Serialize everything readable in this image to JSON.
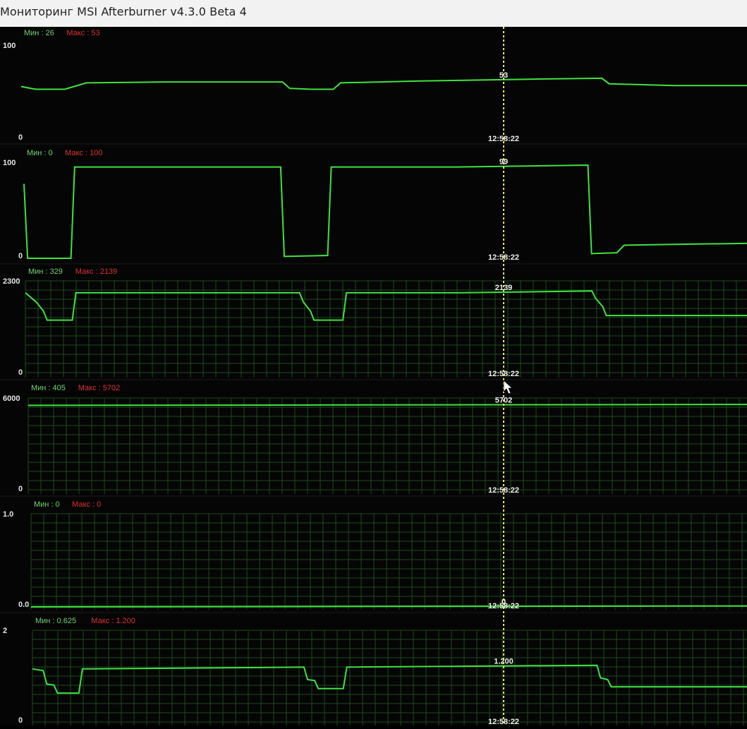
{
  "window": {
    "title": "Мониторинг MSI Afterburner v4.3.0 Beta 4"
  },
  "cursor_time": "12:58:22",
  "colors": {
    "line": "#3fe23f",
    "min_label": "#6fd66f",
    "max_label": "#e03030",
    "cursor": "#e8e860",
    "grid": "#1b4a1b",
    "bg": "#050505"
  },
  "graphs": [
    {
      "id": "graph-1",
      "min_text": "Мин : 26",
      "max_text": "Макс : 53",
      "y_max_label": "100",
      "y_min_label": "0",
      "current_value": "53",
      "time_label": "12:58:22",
      "grid": false,
      "series_percent": [
        [
          0.0,
          58
        ],
        [
          0.02,
          55
        ],
        [
          0.06,
          55
        ],
        [
          0.09,
          62
        ],
        [
          0.2,
          63
        ],
        [
          0.36,
          63
        ],
        [
          0.37,
          56
        ],
        [
          0.4,
          55
        ],
        [
          0.43,
          55
        ],
        [
          0.44,
          62
        ],
        [
          0.55,
          64
        ],
        [
          0.7,
          66
        ],
        [
          0.8,
          67
        ],
        [
          0.81,
          61
        ],
        [
          0.9,
          59
        ],
        [
          1.0,
          59
        ]
      ]
    },
    {
      "id": "graph-2",
      "min_text": "Мин : 0",
      "max_text": "Макс : 100",
      "y_max_label": "100",
      "y_min_label": "0",
      "current_value": "99",
      "time_label": "12:58:22",
      "grid": false,
      "series_percent": [
        [
          0.0,
          80
        ],
        [
          0.005,
          0
        ],
        [
          0.065,
          0
        ],
        [
          0.07,
          98
        ],
        [
          0.25,
          98
        ],
        [
          0.355,
          98
        ],
        [
          0.36,
          2
        ],
        [
          0.42,
          3
        ],
        [
          0.425,
          98
        ],
        [
          0.6,
          98
        ],
        [
          0.78,
          100
        ],
        [
          0.785,
          5
        ],
        [
          0.82,
          6
        ],
        [
          0.83,
          14
        ],
        [
          0.9,
          15
        ],
        [
          1.0,
          16
        ]
      ]
    },
    {
      "id": "graph-3",
      "min_text": "Мин : 329",
      "max_text": "Макс : 2139",
      "y_max_label": "2300",
      "y_min_label": "0",
      "current_value": "2139",
      "time_label": "12:58:22",
      "grid": true,
      "series_percent": [
        [
          0.0,
          90
        ],
        [
          0.015,
          80
        ],
        [
          0.025,
          70
        ],
        [
          0.03,
          60
        ],
        [
          0.065,
          60
        ],
        [
          0.07,
          90
        ],
        [
          0.3,
          90
        ],
        [
          0.38,
          90
        ],
        [
          0.385,
          80
        ],
        [
          0.395,
          70
        ],
        [
          0.4,
          60
        ],
        [
          0.44,
          60
        ],
        [
          0.445,
          90
        ],
        [
          0.6,
          90
        ],
        [
          0.785,
          92
        ],
        [
          0.79,
          84
        ],
        [
          0.8,
          75
        ],
        [
          0.805,
          65
        ],
        [
          1.0,
          65
        ]
      ]
    },
    {
      "id": "graph-4",
      "min_text": "Мин : 405",
      "max_text": "Макс : 5702",
      "y_max_label": "6000",
      "y_min_label": "0",
      "current_value": "5702",
      "time_label": "12:58:22",
      "grid": true,
      "series_percent": [
        [
          0.0,
          95
        ],
        [
          1.0,
          96
        ]
      ]
    },
    {
      "id": "graph-5",
      "min_text": "Мин : 0",
      "max_text": "Макс : 0",
      "y_max_label": "1.0",
      "y_min_label": "0.0",
      "current_value": "0",
      "time_label": "12:58:22",
      "grid": true,
      "series_percent": [
        [
          0.0,
          0
        ],
        [
          1.0,
          1
        ]
      ]
    },
    {
      "id": "graph-6",
      "min_text": "Мин : 0.625",
      "max_text": "Макс : 1.200",
      "y_max_label": "2",
      "y_min_label": "0",
      "current_value": "1.200",
      "time_label": "12:58:22",
      "grid": true,
      "series_percent": [
        [
          0.0,
          60
        ],
        [
          0.015,
          58
        ],
        [
          0.02,
          43
        ],
        [
          0.03,
          42
        ],
        [
          0.035,
          33
        ],
        [
          0.065,
          33
        ],
        [
          0.07,
          60
        ],
        [
          0.38,
          62
        ],
        [
          0.385,
          48
        ],
        [
          0.395,
          47
        ],
        [
          0.4,
          38
        ],
        [
          0.435,
          38
        ],
        [
          0.44,
          62
        ],
        [
          0.79,
          64
        ],
        [
          0.795,
          50
        ],
        [
          0.805,
          48
        ],
        [
          0.81,
          40
        ],
        [
          1.0,
          40
        ]
      ]
    }
  ]
}
